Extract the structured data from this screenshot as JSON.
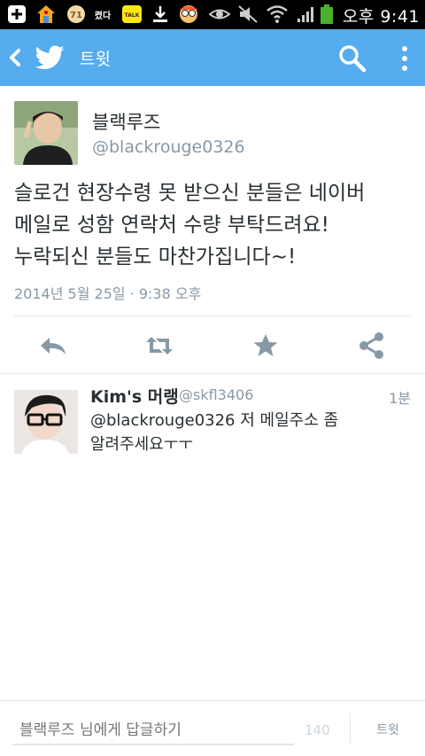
{
  "status_bar": {
    "icons": [
      "add-icon",
      "home-icon",
      "face-icon",
      "notification-badge",
      "kakaotalk-icon",
      "download-icon",
      "pororo-icon",
      "eye-icon",
      "mute-icon",
      "wifi-icon",
      "signal-icon",
      "battery-icon"
    ],
    "badge_71": "71",
    "label_kedda": "켰다",
    "kakao_label": "TALK",
    "time": "오후 9:41"
  },
  "app_bar": {
    "title": "트윗",
    "background": "#55acee"
  },
  "tweet": {
    "author_name": "블랙루즈",
    "author_handle": "@blackrouge0326",
    "text": "슬로건 현장수령 못 받으신 분들은 네이버\n메일로 성함 연락처 수량 부탁드려요!\n누락되신 분들도 마찬가집니다~!",
    "date": "2014년 5월 25일 · 9:38 오후",
    "actions": [
      "reply-icon",
      "retweet-icon",
      "favorite-icon",
      "share-icon"
    ]
  },
  "reply": {
    "author_name": "Kim's 머랭",
    "author_handle": "@skfl3406",
    "time": "1분",
    "text": "@blackrouge0326 저 메일주소 좀\n알려주세요ㅜㅜ"
  },
  "compose": {
    "placeholder": "블랙루즈 님에게 답글하기",
    "char_count": "140",
    "send_label": "트윗"
  }
}
